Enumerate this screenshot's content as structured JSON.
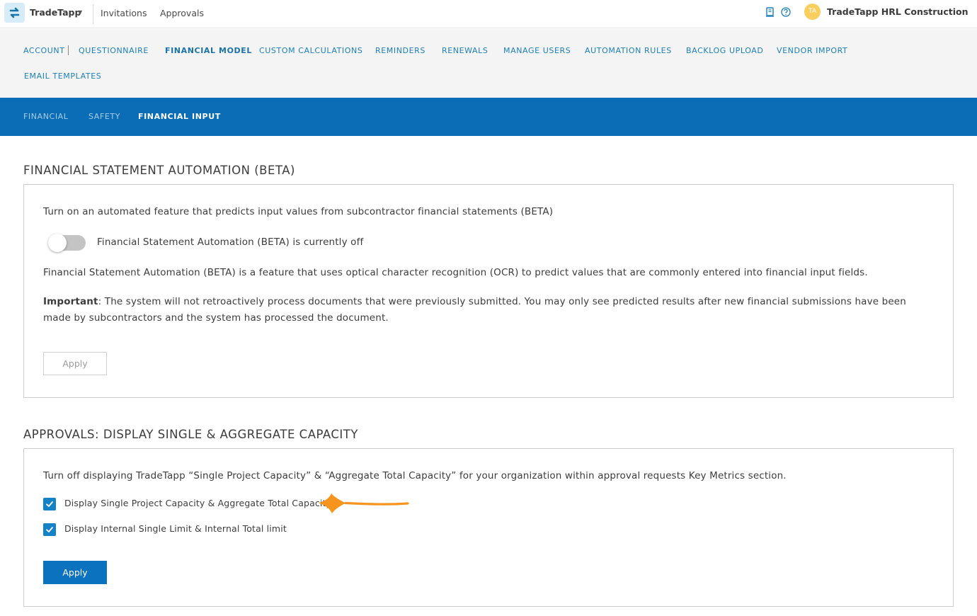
{
  "header": {
    "brand": "TradeTapp",
    "links": [
      "Invitations",
      "Approvals"
    ],
    "avatar_initials": "TA",
    "org_name": "TradeTapp HRL Construction",
    "icons": [
      "book-icon",
      "help-icon"
    ]
  },
  "main_nav": {
    "items": [
      "ACCOUNT",
      "QUESTIONNAIRE",
      "FINANCIAL MODEL",
      "CUSTOM CALCULATIONS",
      "REMINDERS",
      "RENEWALS",
      "MANAGE USERS",
      "AUTOMATION RULES",
      "BACKLOG UPLOAD",
      "VENDOR IMPORT",
      "EMAIL TEMPLATES"
    ],
    "active": "FINANCIAL MODEL"
  },
  "sub_nav": {
    "items": [
      "FINANCIAL",
      "SAFETY",
      "FINANCIAL INPUT"
    ],
    "active": "FINANCIAL INPUT"
  },
  "automation": {
    "title": "FINANCIAL STATEMENT AUTOMATION (BETA)",
    "intro": "Turn on an automated feature that predicts input values from subcontractor financial statements (BETA)",
    "toggle_on": false,
    "toggle_label": "Financial Statement Automation (BETA) is currently off",
    "description": "Financial Statement Automation (BETA) is a feature that uses optical character recognition (OCR) to predict values that are commonly entered into financial input fields.",
    "important_label": "Important",
    "important_text": ": The system will not retroactively process documents that were previously submitted. You may only see predicted results after new financial submissions have been made by subcontractors and the system has processed the document.",
    "apply_label": "Apply"
  },
  "approvals": {
    "title": "APPROVALS: DISPLAY SINGLE & AGGREGATE CAPACITY",
    "intro": "Turn off displaying TradeTapp “Single Project Capacity” & “Aggregate Total Capacity” for your organization within approval requests Key Metrics section.",
    "options": [
      {
        "label": "Display Single Project Capacity & Aggregate Total Capacity",
        "checked": true
      },
      {
        "label": "Display Internal Single Limit & Internal Total limit",
        "checked": true
      }
    ],
    "apply_label": "Apply"
  },
  "colors": {
    "primary": "#0a72be",
    "subnav_bg": "#0a6db5",
    "link": "#1b7fb8",
    "annotation_arrow": "#f7941d",
    "avatar": "#f8cf5c"
  }
}
